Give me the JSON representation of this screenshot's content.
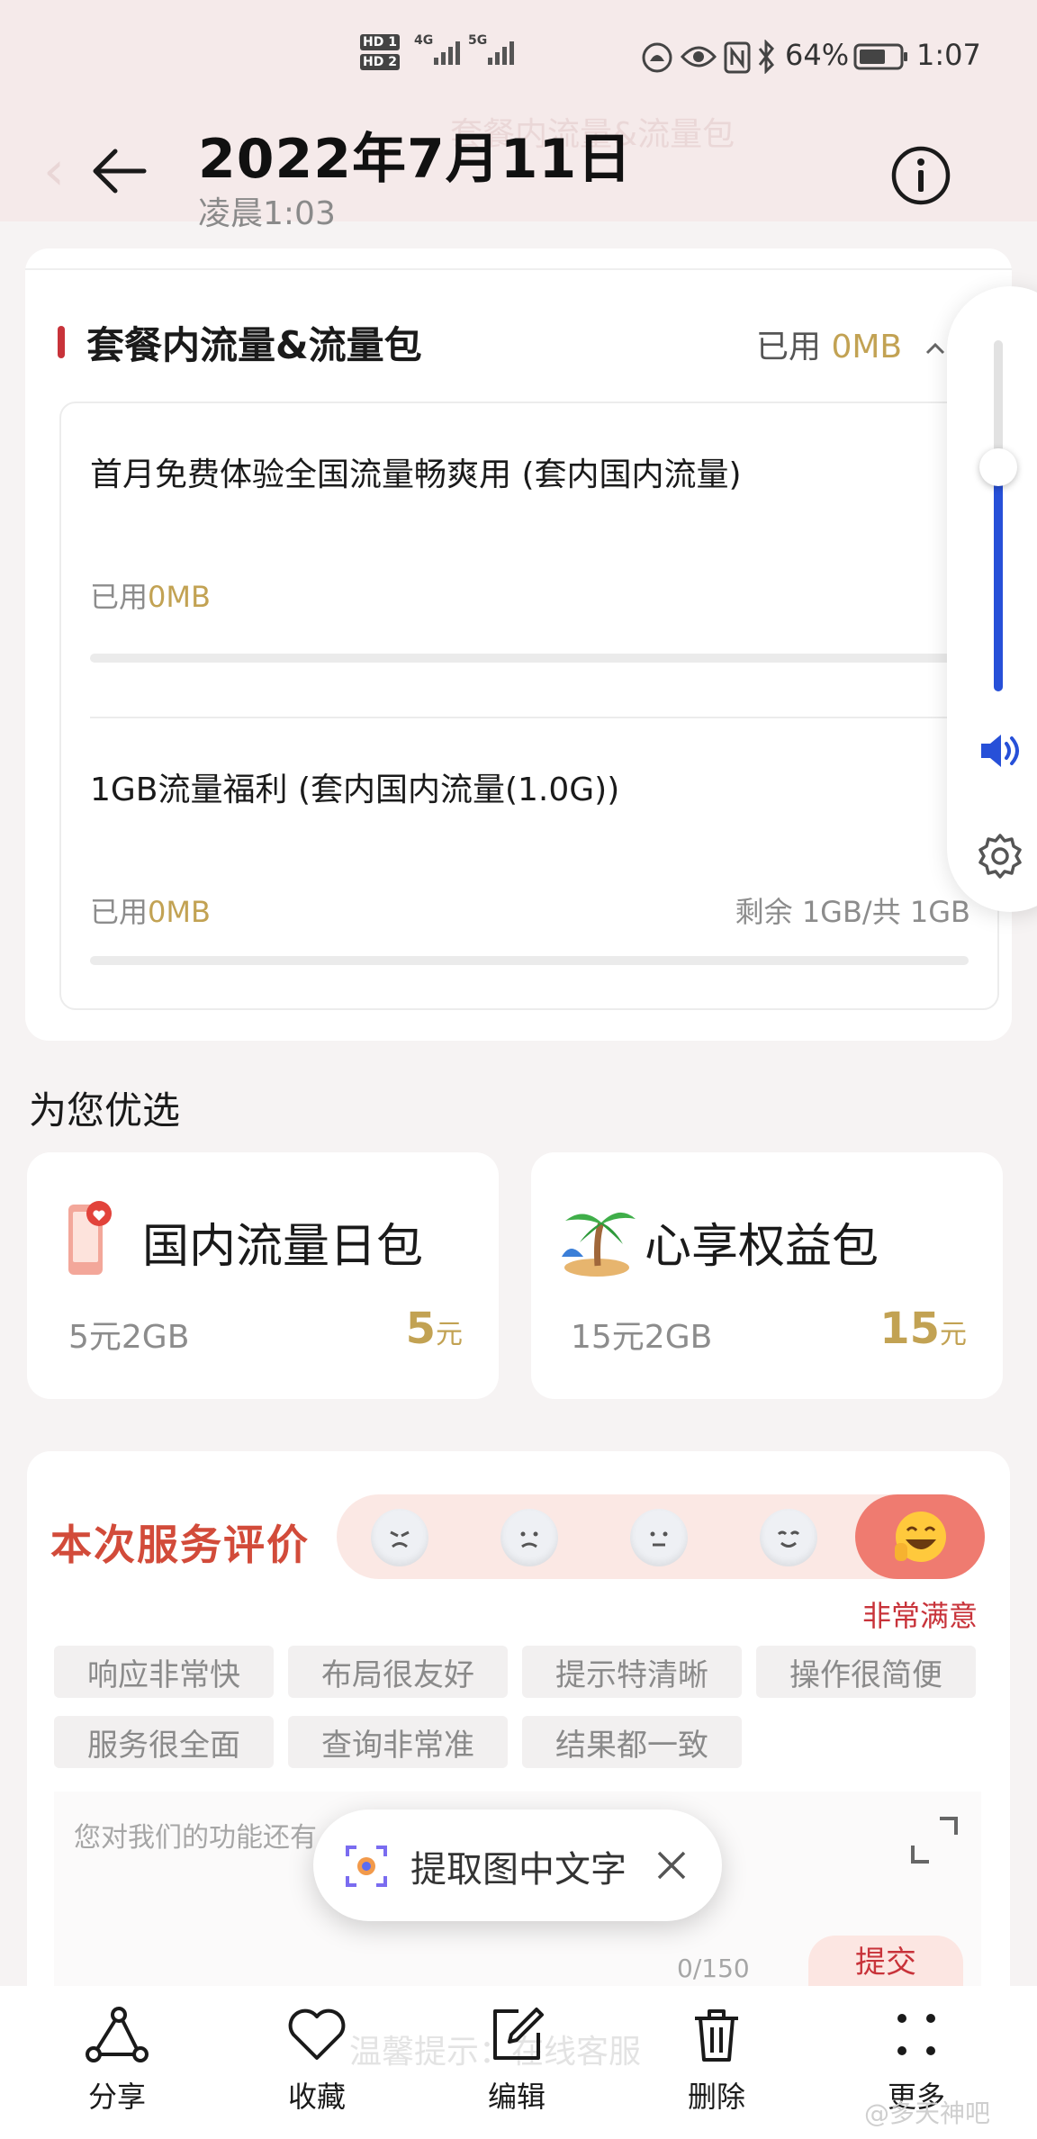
{
  "status_bar": {
    "sim1": "HD 1",
    "sim2": "HD 2",
    "net1": "4G",
    "net2": "5G",
    "battery": "64%",
    "time": "1:07"
  },
  "header": {
    "date": "2022年7月11日",
    "time": "凌晨1:03",
    "faint_title": "套餐内流量&流量包"
  },
  "usage": {
    "section_title": "套餐内流量&流量包",
    "used_label": "已用",
    "used_value": "0MB",
    "items": [
      {
        "name": "首月免费体验全国流量畅爽用 (套内国内流量)",
        "used_label": "已用",
        "used_value": "0MB",
        "remaining": "",
        "progress": 0
      },
      {
        "name": "1GB流量福利 (套内国内流量(1.0G))",
        "used_label": "已用",
        "used_value": "0MB",
        "remaining": "剩余 1GB/共 1GB",
        "progress": 0
      }
    ]
  },
  "volume": {
    "level_percent": 60
  },
  "recommend": {
    "title": "为您优选",
    "offers": [
      {
        "icon": "phone-heart-icon",
        "name": "国内流量日包",
        "desc": "5元2GB",
        "price": "5",
        "unit": "元"
      },
      {
        "icon": "palm-tree-icon",
        "name": "心享权益包",
        "desc": "15元2GB",
        "price": "15",
        "unit": "元"
      }
    ]
  },
  "rating": {
    "title": "本次服务评价",
    "faces": [
      "angry-face-icon",
      "sad-face-icon",
      "neutral-face-icon",
      "smile-face-icon",
      "happy-face-icon"
    ],
    "selected_index": 4,
    "selected_label": "非常满意",
    "tags": [
      "响应非常快",
      "布局很友好",
      "提示特清晰",
      "操作很简便",
      "服务很全面",
      "查询非常准",
      "结果都一致"
    ],
    "placeholder": "您对我们的功能还有",
    "counter": "0/150",
    "submit": "提交"
  },
  "ocr_popup": {
    "label": "提取图中文字"
  },
  "footer_hint": "温馨提示：在线客服",
  "bottom_bar": [
    {
      "icon": "share-icon",
      "label": "分享"
    },
    {
      "icon": "heart-icon",
      "label": "收藏"
    },
    {
      "icon": "edit-icon",
      "label": "编辑"
    },
    {
      "icon": "trash-icon",
      "label": "删除"
    },
    {
      "icon": "more-icon",
      "label": "更多"
    }
  ],
  "watermark": "@多天神吧",
  "colors": {
    "accent_gold": "#c2a253",
    "accent_red": "#c8333a",
    "volume_blue": "#2750d8",
    "header_bg": "#f5eaea"
  }
}
